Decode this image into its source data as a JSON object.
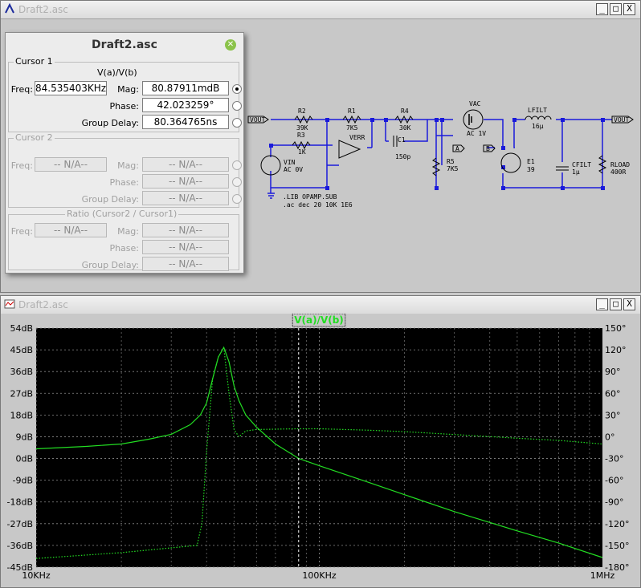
{
  "schematic_window": {
    "title": "Draft2.asc",
    "buttons": {
      "minimize": "_",
      "maximize": "□",
      "close": "X"
    }
  },
  "cursor_dialog": {
    "title": "Draft2.asc",
    "cursor1": {
      "group": "Cursor 1",
      "expr": "V(a)/V(b)",
      "freq_label": "Freq:",
      "freq": "84.535403KHz",
      "mag_label": "Mag:",
      "mag": "80.87911mdB",
      "phase_label": "Phase:",
      "phase": "42.023259°",
      "gd_label": "Group Delay:",
      "gd": "80.364765ns"
    },
    "cursor2": {
      "group": "Cursor 2",
      "freq_label": "Freq:",
      "freq": "-- N/A--",
      "mag_label": "Mag:",
      "mag": "-- N/A--",
      "phase_label": "Phase:",
      "phase": "-- N/A--",
      "gd_label": "Group Delay:",
      "gd": "-- N/A--"
    },
    "ratio": {
      "group": "Ratio (Cursor2 / Cursor1)",
      "freq_label": "Freq:",
      "freq": "-- N/A--",
      "mag_label": "Mag:",
      "mag": "-- N/A--",
      "phase_label": "Phase:",
      "phase": "-- N/A--",
      "gd_label": "Group Delay:",
      "gd": "-- N/A--"
    }
  },
  "schematic": {
    "labels": [
      "VOUT",
      "R2",
      "39K",
      "R3",
      "1K",
      "R1",
      "7K5",
      "VERR",
      "R4",
      "30K",
      "C1",
      "150p",
      "VAC",
      "AC 1V",
      "LFILT",
      "16µ",
      "VOUT",
      "R5",
      "7K5",
      "E1",
      "39",
      "CFILT",
      "1µ",
      "RLOAD",
      "400R",
      "VIN",
      "AC 0V",
      ".LIB OPAMP.SUB",
      ".ac dec 20 10K 1E6",
      "A",
      "B"
    ]
  },
  "plot_window": {
    "title": "Draft2.asc",
    "trace_label": "V(a)/V(b)",
    "buttons": {
      "minimize": "_",
      "maximize": "□",
      "close": "X"
    }
  },
  "chart_data": {
    "type": "line",
    "title": "V(a)/V(b)",
    "x_scale": "log",
    "xlim": [
      10000,
      1000000
    ],
    "x_ticks": [
      "10KHz",
      "100KHz",
      "1MHz"
    ],
    "ylim_left": [
      -45,
      54
    ],
    "y_ticks_left": [
      "54dB",
      "45dB",
      "36dB",
      "27dB",
      "18dB",
      "9dB",
      "0dB",
      "-9dB",
      "-18dB",
      "-27dB",
      "-36dB",
      "-45dB"
    ],
    "ylim_right": [
      -180,
      150
    ],
    "y_ticks_right": [
      "150°",
      "120°",
      "90°",
      "60°",
      "30°",
      "0°",
      "-30°",
      "-60°",
      "-90°",
      "-120°",
      "-150°",
      "-180°"
    ],
    "cursor_x": 84535.403,
    "series": [
      {
        "kind": "magnitude",
        "style": "solid",
        "x": [
          10000,
          15000,
          20000,
          25000,
          30000,
          35000,
          38000,
          40000,
          42000,
          44000,
          46000,
          48000,
          50000,
          52000,
          55000,
          60000,
          70000,
          84535,
          100000,
          150000,
          200000,
          300000,
          500000,
          700000,
          1000000
        ],
        "y": [
          4,
          5,
          6,
          8,
          10,
          14,
          18,
          23,
          33,
          42,
          46,
          40,
          30,
          24,
          18,
          13,
          6,
          0,
          -3,
          -10,
          -15,
          -22,
          -30,
          -35,
          -41
        ]
      },
      {
        "kind": "phase",
        "style": "dotted",
        "x": [
          10000,
          20000,
          37000,
          38500,
          40000,
          42000,
          44000,
          46000,
          48000,
          50000,
          52000,
          55000,
          60000,
          84535,
          100000,
          150000,
          200000,
          300000,
          500000,
          700000,
          1000000
        ],
        "y": [
          -168,
          -160,
          -150,
          -120,
          -20,
          80,
          110,
          123,
          60,
          10,
          0,
          8,
          10,
          11,
          11,
          9,
          7,
          3,
          -2,
          -5,
          -10
        ]
      }
    ]
  },
  "colors": {
    "trace": "#22dd22",
    "plot_bg": "#000000",
    "wire": "#1a1adb",
    "junction": "#1a1adb"
  }
}
